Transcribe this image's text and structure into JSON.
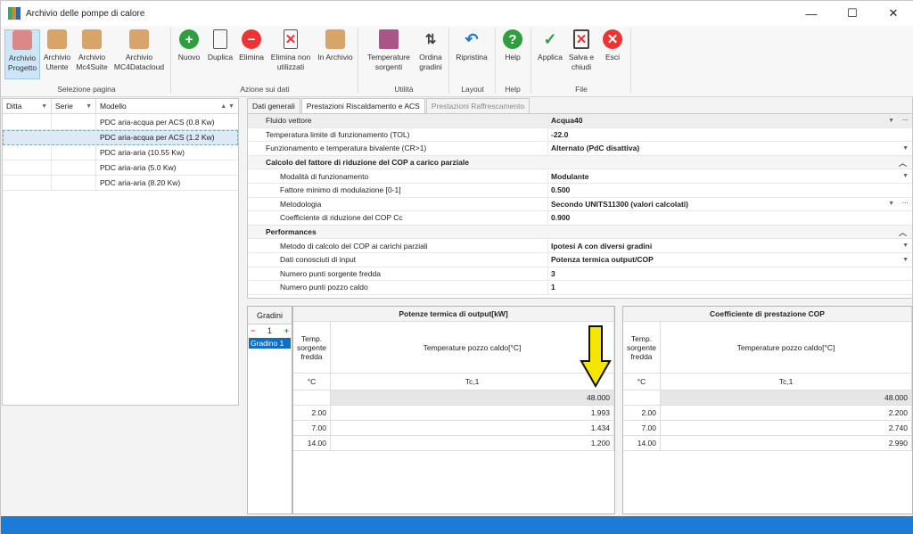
{
  "window": {
    "title": "Archivio delle pompe di calore",
    "minimize": "—",
    "maximize": "☐",
    "close": "✕"
  },
  "ribbon": {
    "buttons": [
      {
        "id": "archivio-progetto",
        "label": "Archivio Progetto"
      },
      {
        "id": "archivio-utente",
        "label": "Archivio Utente"
      },
      {
        "id": "archivio-mc4suite",
        "label": "Archivio Mc4Suite"
      },
      {
        "id": "archivio-mc4datacloud",
        "label": "Archivio MC4Datacloud"
      },
      {
        "id": "nuovo",
        "label": "Nuovo"
      },
      {
        "id": "duplica",
        "label": "Duplica"
      },
      {
        "id": "elimina",
        "label": "Elimina"
      },
      {
        "id": "elimina-non-utilizzati",
        "label": "Elimina non utilizzati"
      },
      {
        "id": "in-archivio",
        "label": "In Archivio"
      },
      {
        "id": "temperature-sorgenti",
        "label": "Temperature sorgenti"
      },
      {
        "id": "ordina-gradini",
        "label": "Ordina gradini"
      },
      {
        "id": "ripristina",
        "label": "Ripristina"
      },
      {
        "id": "help",
        "label": "Help"
      },
      {
        "id": "applica",
        "label": "Applica"
      },
      {
        "id": "salva-e-chiudi",
        "label": "Salva e chiudi"
      },
      {
        "id": "esci",
        "label": "Esci"
      }
    ],
    "groups": [
      "Selezione pagina",
      "Azione sui dati",
      "Utilità",
      "Layout",
      "Help",
      "File"
    ]
  },
  "list": {
    "columns": [
      "Ditta",
      "Serie",
      "Modello"
    ],
    "rows": [
      {
        "modello": "PDC aria-acqua per ACS (0.8 Kw)"
      },
      {
        "modello": "PDC aria-acqua per ACS (1.2 Kw)"
      },
      {
        "modello": "PDC aria-aria (10.55 Kw)"
      },
      {
        "modello": "PDC aria-aria (5.0 Kw)"
      },
      {
        "modello": "PDC aria-aria (8.20 Kw)"
      }
    ]
  },
  "tabs": [
    "Dati generali",
    "Prestazioni Riscaldamento e ACS",
    "Prestazioni Raffrescamento"
  ],
  "props": {
    "fluido": {
      "k": "Fluido vettore",
      "v": "Acqua40"
    },
    "tol": {
      "k": "Temperatura limite di funzionamento (TOL)",
      "v": "-22.0"
    },
    "funz": {
      "k": "Funzionamento e temperatura bivalente (CR>1)",
      "v": "Alternato (PdC disattiva)"
    },
    "cat1": "Calcolo del fattore di riduzione del COP a carico parziale",
    "modalita": {
      "k": "Modalità di funzionamento",
      "v": "Modulante"
    },
    "fattore": {
      "k": "Fattore minimo di modulazione [0-1]",
      "v": "0.500"
    },
    "metodologia": {
      "k": "Metodologia",
      "v": "Secondo UNITS11300 (valori calcolati)"
    },
    "coeff": {
      "k": "Coefficiente di riduzione del COP Cc",
      "v": "0.900"
    },
    "cat2": "Performances",
    "metodo": {
      "k": "Metodo di calcolo del COP ai carichi parziali",
      "v": "Ipotesi A con diversi gradini"
    },
    "dati": {
      "k": "Dati conosciuti di input",
      "v": "Potenza termica output/COP"
    },
    "nfredda": {
      "k": "Numero punti sorgente fredda",
      "v": "3"
    },
    "ncaldo": {
      "k": "Numero punti pozzo caldo",
      "v": "1"
    }
  },
  "gradini": {
    "title": "Gradini",
    "count": "1",
    "item": "Gradino 1",
    "minus": "−",
    "plus": "+"
  },
  "potenze": {
    "title": "Potenze termica di output[kW]",
    "col1": "Temp. sorgente fredda",
    "col2": "Temperature pozzo caldo[°C]",
    "unit": "°C",
    "sub": "Tc,1",
    "hot": "48.000",
    "rows": [
      {
        "t": "2.00",
        "v": "1.993"
      },
      {
        "t": "7.00",
        "v": "1.434"
      },
      {
        "t": "14.00",
        "v": "1.200"
      }
    ]
  },
  "cop": {
    "title": "Coefficiente di prestazione COP",
    "col1": "Temp. sorgente fredda",
    "col2": "Temperature pozzo caldo[°C]",
    "unit": "°C",
    "sub": "Tc,1",
    "hot": "48.000",
    "rows": [
      {
        "t": "2.00",
        "v": "2.200"
      },
      {
        "t": "7.00",
        "v": "2.740"
      },
      {
        "t": "14.00",
        "v": "2.990"
      }
    ]
  },
  "colors": {
    "accent": "#1c7bd4",
    "arrow": "#f5e600",
    "selection": "#0b6fc6"
  }
}
